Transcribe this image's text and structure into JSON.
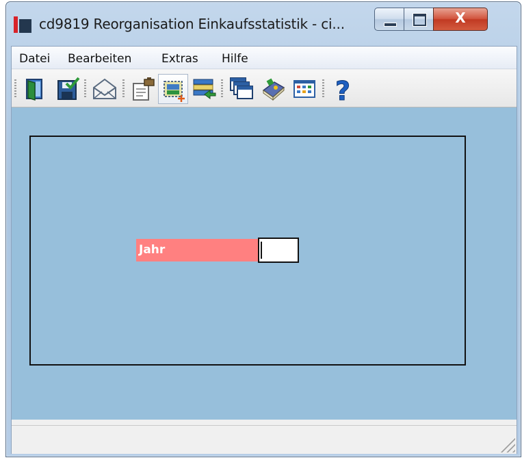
{
  "window": {
    "title": "cd9819 Reorganisation Einkaufsstatistik - ci..."
  },
  "title_controls": {
    "minimize_icon": "minimize-icon",
    "maximize_icon": "maximize-icon",
    "close_glyph": "X"
  },
  "menu": {
    "items": [
      {
        "label": "Datei"
      },
      {
        "label": "Bearbeiten"
      },
      {
        "label": "Extras"
      },
      {
        "label": "Hilfe"
      }
    ]
  },
  "toolbar": {
    "buttons": [
      {
        "icon": "exit-door-icon"
      },
      {
        "icon": "save-check-icon"
      },
      {
        "icon": "mail-envelope-icon"
      },
      {
        "icon": "document-stamp-icon"
      },
      {
        "icon": "new-record-icon",
        "active": true
      },
      {
        "icon": "list-import-icon"
      },
      {
        "icon": "windows-cascade-icon"
      },
      {
        "icon": "book-icon"
      },
      {
        "icon": "calendar-grid-icon"
      },
      {
        "icon": "help-question-icon",
        "glyph": "?"
      }
    ]
  },
  "form": {
    "jahr_label": "Jahr",
    "jahr_value": ""
  },
  "colors": {
    "canvas_bg": "#97bfdb",
    "label_bg": "#ff8080",
    "label_text": "#ffffff",
    "close_button": "#c13a22"
  }
}
